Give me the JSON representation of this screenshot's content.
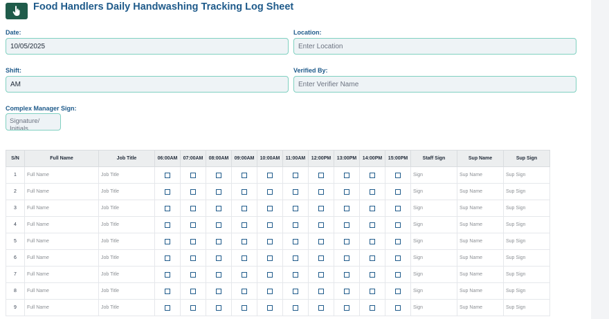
{
  "header": {
    "title": "Food Handlers Daily Handwashing Tracking Log Sheet",
    "logo_icon": "hand-pointer-icon"
  },
  "form": {
    "date": {
      "label": "Date:",
      "value": "10/05/2025"
    },
    "location": {
      "label": "Location:",
      "placeholder": "Enter Location"
    },
    "shift": {
      "label": "Shift:",
      "value": "AM"
    },
    "verified_by": {
      "label": "Verified By:",
      "placeholder": "Enter Verifier Name"
    },
    "complex_manager_sign": {
      "label": "Complex Manager Sign:",
      "placeholder": "Signature/ Initials"
    }
  },
  "table": {
    "columns": [
      "S/N",
      "Full Name",
      "Job Title",
      "06:00AM",
      "07:00AM",
      "08:00AM",
      "09:00AM",
      "10:00AM",
      "11:00AM",
      "12:00PM",
      "13:00PM",
      "14:00PM",
      "15:00PM",
      "Staff Sign",
      "Sup Name",
      "Sup Sign"
    ],
    "rows": [
      {
        "sn": "1",
        "full_name": "Full Name",
        "job_title": "Job Title",
        "staff_sign": "Sign",
        "sup_name": "Sup Name",
        "sup_sign": "Sup Sign"
      },
      {
        "sn": "2",
        "full_name": "Full Name",
        "job_title": "Job Title",
        "staff_sign": "Sign",
        "sup_name": "Sup Name",
        "sup_sign": "Sup Sign"
      },
      {
        "sn": "3",
        "full_name": "Full Name",
        "job_title": "Job Title",
        "staff_sign": "Sign",
        "sup_name": "Sup Name",
        "sup_sign": "Sup Sign"
      },
      {
        "sn": "4",
        "full_name": "Full Name",
        "job_title": "Job Title",
        "staff_sign": "Sign",
        "sup_name": "Sup Name",
        "sup_sign": "Sup Sign"
      },
      {
        "sn": "5",
        "full_name": "Full Name",
        "job_title": "Job Title",
        "staff_sign": "Sign",
        "sup_name": "Sup Name",
        "sup_sign": "Sup Sign"
      },
      {
        "sn": "6",
        "full_name": "Full Name",
        "job_title": "Job Title",
        "staff_sign": "Sign",
        "sup_name": "Sup Name",
        "sup_sign": "Sup Sign"
      },
      {
        "sn": "7",
        "full_name": "Full Name",
        "job_title": "Job Title",
        "staff_sign": "Sign",
        "sup_name": "Sup Name",
        "sup_sign": "Sup Sign"
      },
      {
        "sn": "8",
        "full_name": "Full Name",
        "job_title": "Job Title",
        "staff_sign": "Sign",
        "sup_name": "Sup Name",
        "sup_sign": "Sup Sign"
      },
      {
        "sn": "9",
        "full_name": "Full Name",
        "job_title": "Job Title",
        "staff_sign": "Sign",
        "sup_name": "Sup Name",
        "sup_sign": "Sup Sign"
      }
    ]
  },
  "colors": {
    "accent": "#1e5a8a",
    "logo_bg": "#1f5b4a",
    "field_border": "#7fd0c0",
    "field_bg": "#eef3f6"
  }
}
